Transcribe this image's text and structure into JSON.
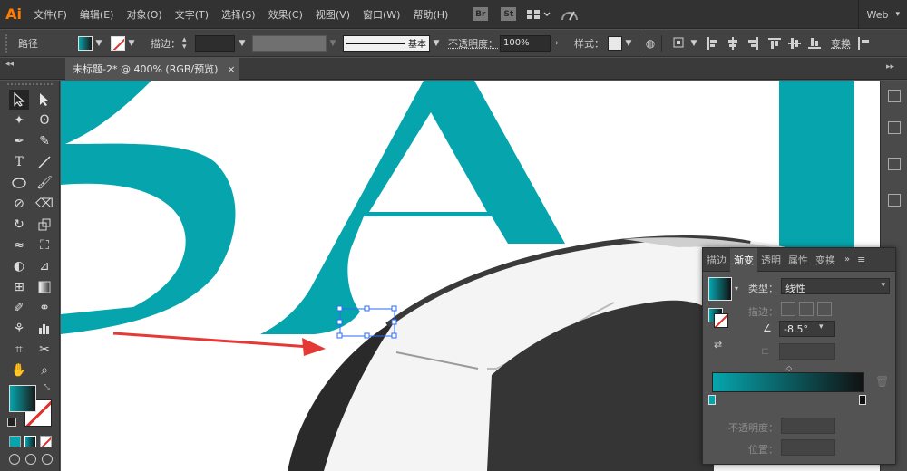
{
  "app": {
    "logo": "Ai"
  },
  "menu": {
    "items": [
      "文件(F)",
      "编辑(E)",
      "对象(O)",
      "文字(T)",
      "选择(S)",
      "效果(C)",
      "视图(V)",
      "窗口(W)",
      "帮助(H)"
    ],
    "bridge": "Br",
    "stock": "St",
    "workspace": "Web"
  },
  "control_bar": {
    "selection_label": "路径",
    "stroke_label": "描边：",
    "brush_label": "基本",
    "opacity_label": "不透明度：",
    "opacity_value": "100%",
    "style_label": "样式：",
    "transform_label": "变换"
  },
  "document_tab": {
    "title": "未标题-2* @ 400% (RGB/预览)",
    "close": "×"
  },
  "artwork": {
    "letters": [
      "B",
      "A",
      "I"
    ],
    "letter_color": "#06a5ad",
    "arrow_color": "#e53935"
  },
  "gradient_panel": {
    "tabs": [
      "描边",
      "渐变",
      "透明",
      "属性",
      "变换"
    ],
    "active_tab": "渐变",
    "type_label": "类型：",
    "type_value": "线性",
    "stroke_label": "描边：",
    "angle_value": "-8.5°",
    "opacity_label": "不透明度：",
    "location_label": "位置：",
    "gradient_start": "#06a5ad",
    "gradient_end": "#111111"
  },
  "colors": {
    "teal": "#06a5ad",
    "ui_dark": "#323232",
    "ui_mid": "#424242",
    "ui_panel": "#535353"
  }
}
